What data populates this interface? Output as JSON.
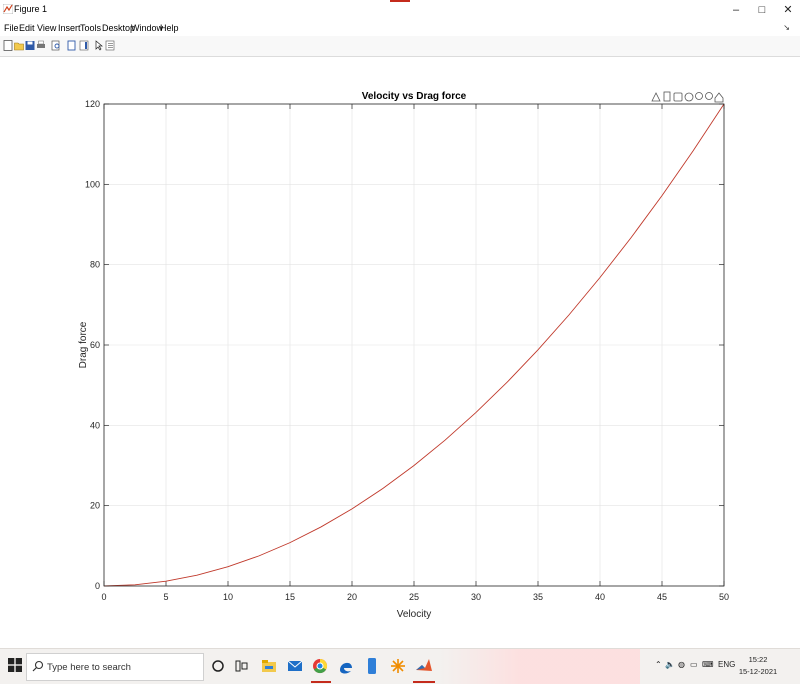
{
  "window": {
    "title": "Figure 1",
    "minimize": "–",
    "maximize": "□",
    "close": "✕"
  },
  "menu": [
    "File",
    "Edit",
    "View",
    "Insert",
    "Tools",
    "Desktop",
    "Window",
    "Help"
  ],
  "toolbar_icons": [
    "new-figure-icon",
    "open-file-icon",
    "save-icon",
    "print-icon",
    "print-preview-icon",
    "link-plot-icon",
    "insert-colorbar-icon",
    "pointer-icon",
    "property-inspector-icon"
  ],
  "axes_toolbar_icons": [
    "brush-icon",
    "data-tip-icon",
    "rotate-icon",
    "pan-icon",
    "zoom-in-icon",
    "zoom-out-icon",
    "home-icon"
  ],
  "chart_data": {
    "type": "line",
    "title": "Velocity vs Drag force",
    "xlabel": "Velocity",
    "ylabel": "Drag force",
    "xlim": [
      0,
      50
    ],
    "ylim": [
      0,
      120
    ],
    "xticks": [
      0,
      5,
      10,
      15,
      20,
      25,
      30,
      35,
      40,
      45,
      50
    ],
    "yticks": [
      0,
      20,
      40,
      60,
      80,
      100,
      120
    ],
    "grid": true,
    "series": [
      {
        "color": "#c0392b",
        "x": [
          0,
          2.5,
          5,
          7.5,
          10,
          12.5,
          15,
          17.5,
          20,
          22.5,
          25,
          27.5,
          30,
          32.5,
          35,
          37.5,
          40,
          42.5,
          45,
          47.5,
          50
        ],
        "y": [
          0,
          0.3,
          1.2,
          2.7,
          4.8,
          7.5,
          10.8,
          14.7,
          19.2,
          24.3,
          30.0,
          36.3,
          43.2,
          50.7,
          58.8,
          67.5,
          76.8,
          86.7,
          97.2,
          108.3,
          120.0
        ]
      }
    ]
  },
  "taskbar": {
    "search_placeholder": "Type here to search",
    "apps": [
      "cortana-icon",
      "task-view-icon",
      "file-explorer-icon",
      "mail-icon",
      "chrome-icon",
      "edge-icon",
      "phone-icon",
      "sunburst-app-icon",
      "matlab-icon"
    ],
    "language": "ENG",
    "time": "15:22",
    "date": "15-12-2021"
  }
}
